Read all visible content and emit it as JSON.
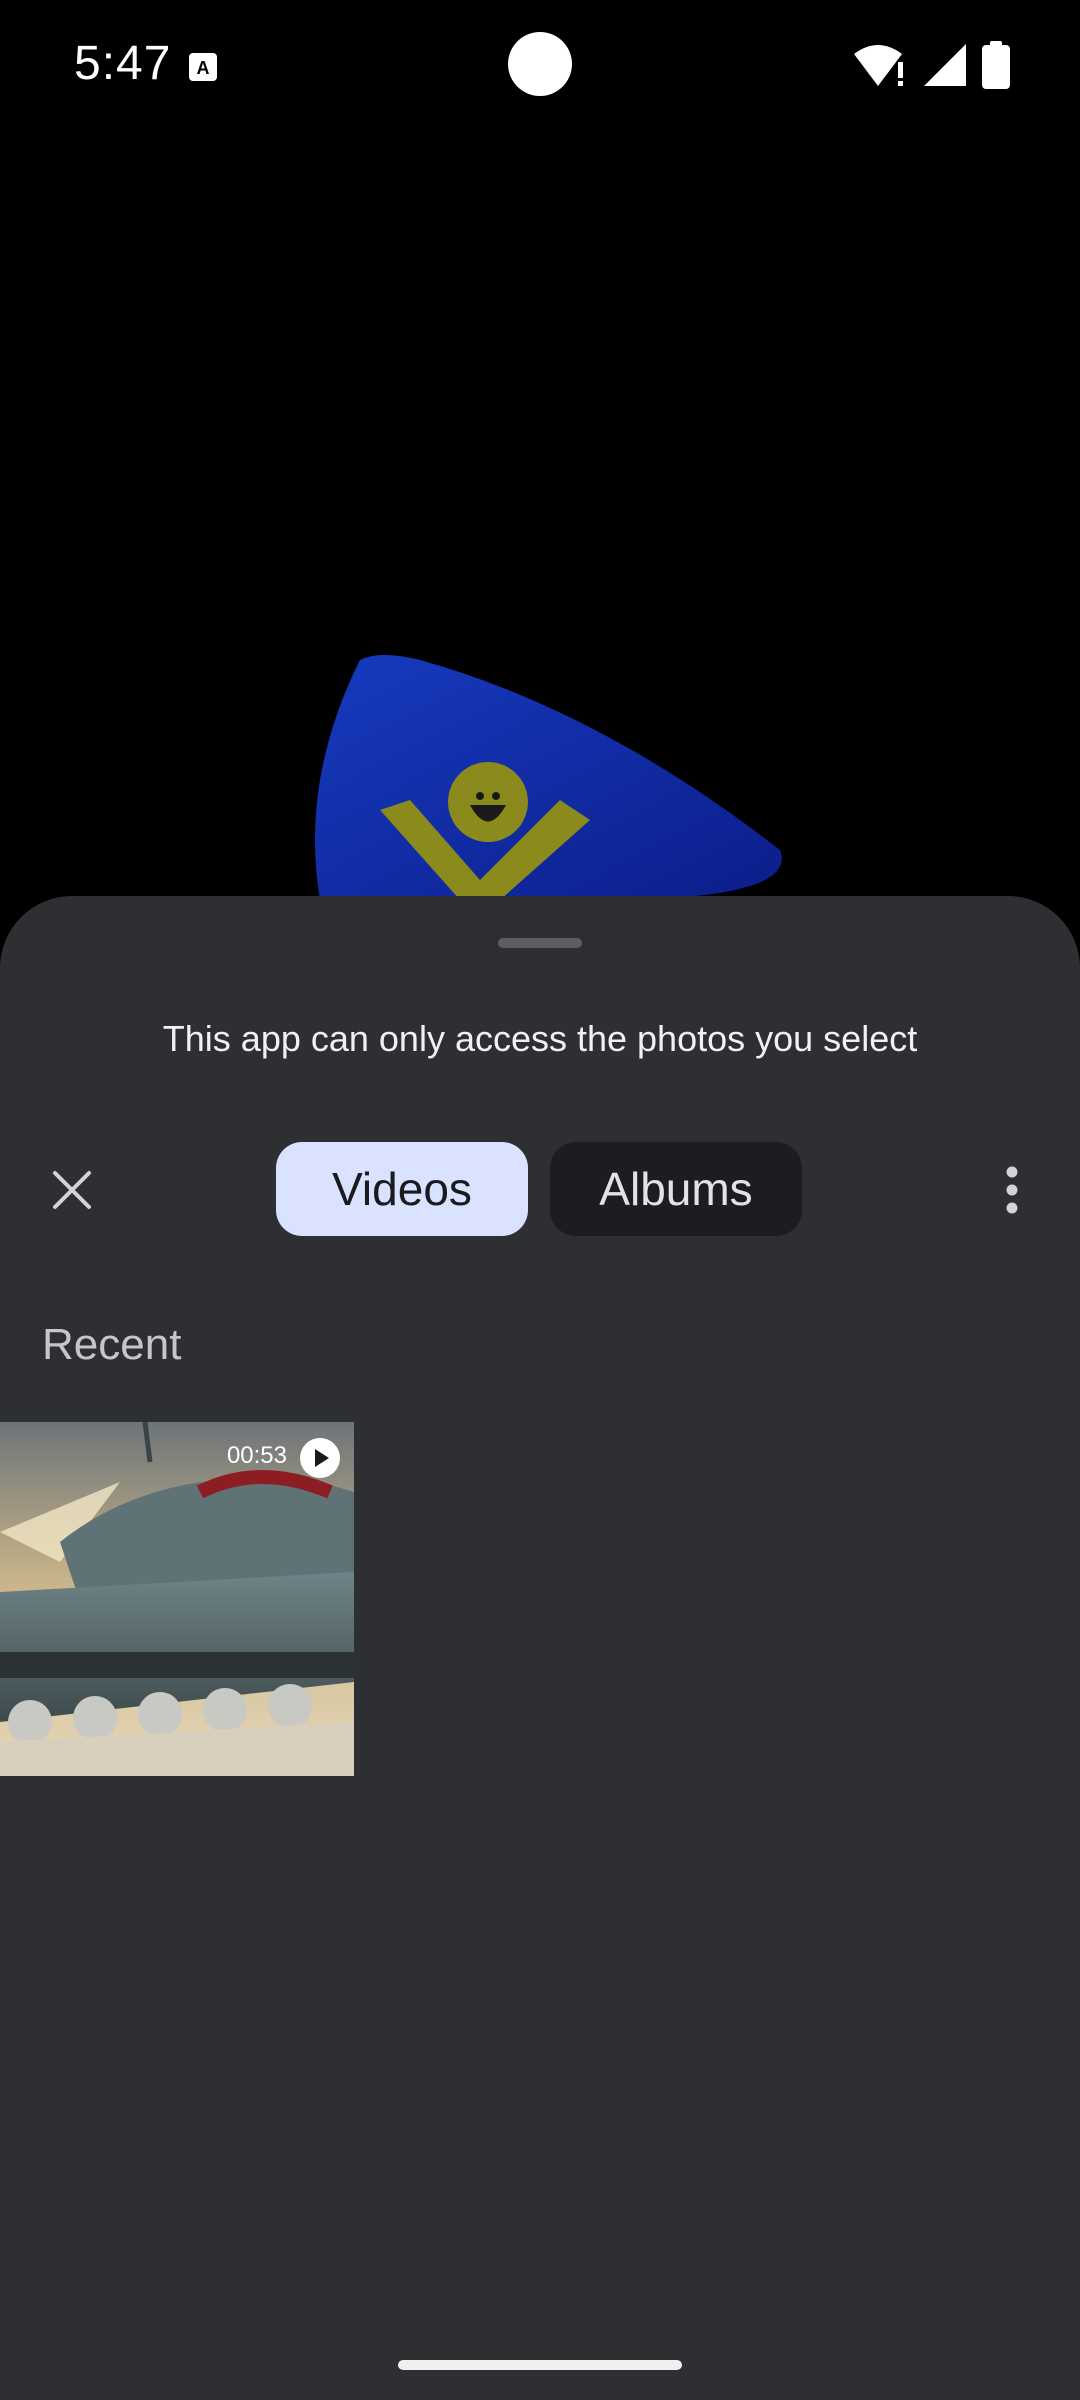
{
  "status_bar": {
    "time": "5:47",
    "icons": [
      "keyboard-a-icon",
      "wifi-alert-icon",
      "cell-signal-icon",
      "battery-icon"
    ]
  },
  "picker": {
    "notice": "This app can only access the photos you select",
    "close_icon": "close-icon",
    "more_icon": "more-vert-icon",
    "tabs": [
      {
        "label": "Videos",
        "selected": true
      },
      {
        "label": "Albums",
        "selected": false
      }
    ],
    "section": {
      "title": "Recent",
      "items": [
        {
          "type": "video",
          "duration": "00:53",
          "icon": "play-icon"
        }
      ]
    }
  },
  "colors": {
    "sheet_bg": "#2e2f33",
    "tab_selected_bg": "#d9e2ff",
    "tab_unselected_bg": "#1c1d21",
    "logo_blue": "#0f2aa8",
    "logo_yellow": "#8b8a1c"
  }
}
